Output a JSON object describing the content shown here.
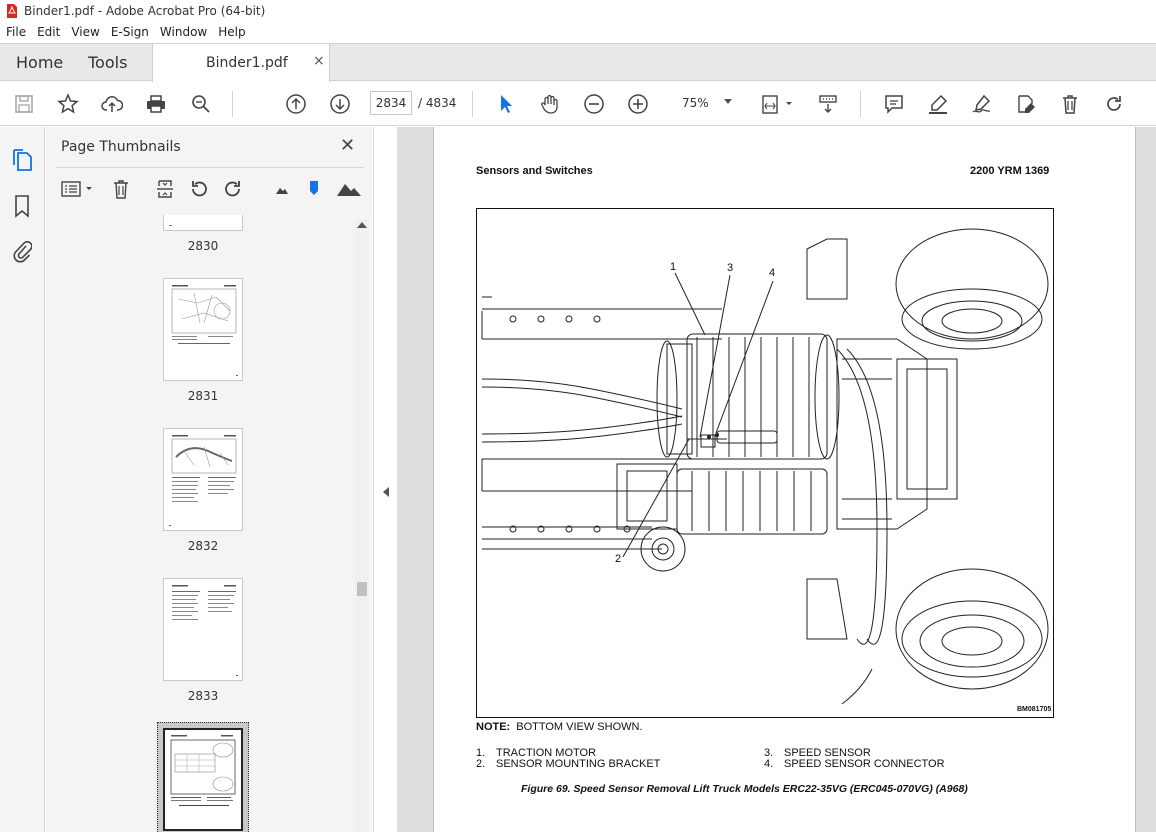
{
  "window": {
    "title": "Binder1.pdf - Adobe Acrobat Pro (64-bit)"
  },
  "menu": [
    "File",
    "Edit",
    "View",
    "E-Sign",
    "Window",
    "Help"
  ],
  "tabs": {
    "home": "Home",
    "tools": "Tools",
    "document": "Binder1.pdf",
    "close": "×"
  },
  "toolbar": {
    "current_page": "2834",
    "page_total": "/  4834",
    "zoom": "75%",
    "icons": [
      "save-icon",
      "bookmark-star-icon",
      "upload-icon",
      "print-icon",
      "zoom-search-icon",
      "page-up-icon",
      "page-down-icon",
      "select-cursor-icon",
      "hand-icon",
      "zoom-out-icon",
      "zoom-in-icon",
      "fit-page-icon",
      "scroll-mode-icon",
      "comment-icon",
      "highlight-icon",
      "sign-icon",
      "edit-icon",
      "delete-icon",
      "redo-icon"
    ]
  },
  "panel": {
    "title": "Page Thumbnails",
    "close": "✕",
    "thumbnails": [
      {
        "label": "2830"
      },
      {
        "label": "2831"
      },
      {
        "label": "2832"
      },
      {
        "label": "2833"
      },
      {
        "label": "2834"
      }
    ]
  },
  "document": {
    "header_left": "Sensors and Switches",
    "header_right": "2200 YRM 1369",
    "figure_code": "BM081705",
    "callouts": [
      "1",
      "3",
      "4",
      "2"
    ],
    "note_label": "NOTE:",
    "note_text": "BOTTOM VIEW SHOWN.",
    "legend": [
      {
        "num": "1.",
        "text": "TRACTION MOTOR"
      },
      {
        "num": "2.",
        "text": "SENSOR MOUNTING BRACKET"
      },
      {
        "num": "3.",
        "text": "SPEED SENSOR"
      },
      {
        "num": "4.",
        "text": "SPEED SENSOR CONNECTOR"
      }
    ],
    "caption": "Figure 69. Speed Sensor Removal Lift Truck Models ERC22-35VG (ERC045-070VG) (A968)"
  },
  "colors": {
    "accent_blue": "#1473e6",
    "pdf_red": "#d9281e"
  }
}
